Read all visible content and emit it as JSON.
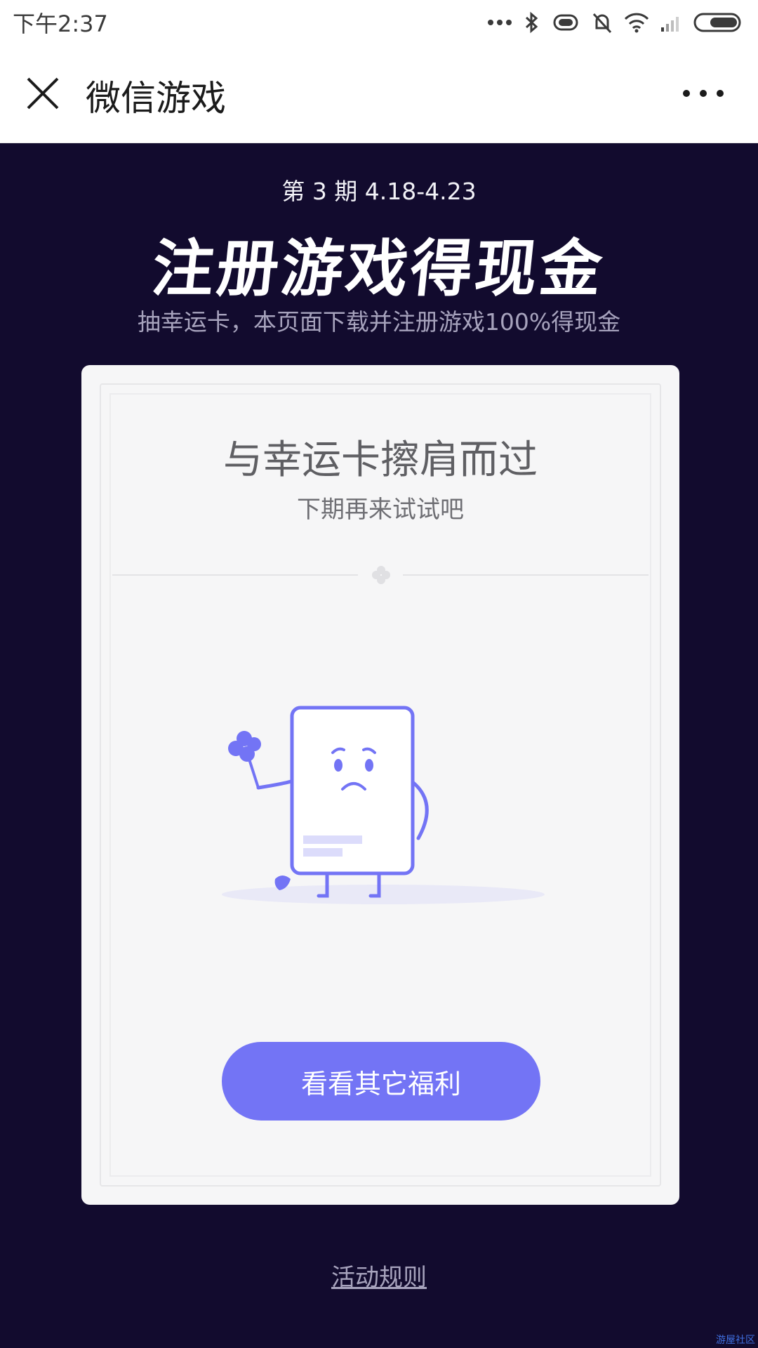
{
  "status_bar": {
    "time": "下午2:37"
  },
  "nav": {
    "title": "微信游戏"
  },
  "banner": {
    "period": "第 3 期 4.18-4.23",
    "headline": "注册游戏得现金",
    "subline": "抽幸运卡，本页面下载并注册游戏100%得现金"
  },
  "card": {
    "title": "与幸运卡擦肩而过",
    "subtitle": "下期再来试试吧",
    "cta_label": "看看其它福利"
  },
  "footer": {
    "rules_link": "活动规则",
    "watermark": "游屋社区"
  },
  "colors": {
    "background": "#120b2e",
    "accent": "#7374f5",
    "card": "#f6f6f7"
  },
  "icons": [
    "close-icon",
    "more-icon",
    "bluetooth-icon",
    "vibrate-icon",
    "mute-bell-icon",
    "wifi-icon",
    "signal-icon",
    "battery-icon",
    "clover-icon"
  ]
}
